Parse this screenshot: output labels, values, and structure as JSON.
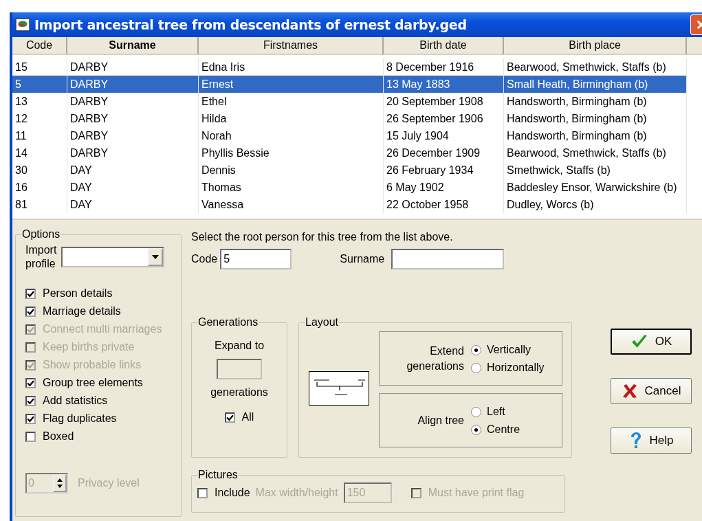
{
  "window": {
    "title": "Import ancestral tree from descendants of ernest darby.ged"
  },
  "table": {
    "columns": [
      {
        "label": "Code",
        "sorted": false
      },
      {
        "label": "Surname",
        "sorted": true
      },
      {
        "label": "Firstnames",
        "sorted": false
      },
      {
        "label": "Birth date",
        "sorted": false
      },
      {
        "label": "Birth place",
        "sorted": false
      }
    ],
    "rows": [
      {
        "cells": [
          "15",
          "DARBY",
          "Edna Iris",
          "8 December 1916",
          "Bearwood, Smethwick, Staffs (b)"
        ],
        "selected": false
      },
      {
        "cells": [
          "5",
          "DARBY",
          "Ernest",
          "13 May 1883",
          "Small Heath, Birmingham (b)"
        ],
        "selected": true
      },
      {
        "cells": [
          "13",
          "DARBY",
          "Ethel",
          "20 September 1908",
          "Handsworth, Birmingham (b)"
        ],
        "selected": false
      },
      {
        "cells": [
          "12",
          "DARBY",
          "Hilda",
          "26 September 1906",
          "Handsworth, Birmingham (b)"
        ],
        "selected": false
      },
      {
        "cells": [
          "11",
          "DARBY",
          "Norah",
          "15 July 1904",
          "Handsworth, Birmingham (b)"
        ],
        "selected": false
      },
      {
        "cells": [
          "14",
          "DARBY",
          "Phyllis Bessie",
          "26 December 1909",
          "Bearwood, Smethwick, Staffs (b)"
        ],
        "selected": false
      },
      {
        "cells": [
          "30",
          "DAY",
          "Dennis",
          "26 February 1934",
          "Smethwick, Staffs (b)"
        ],
        "selected": false
      },
      {
        "cells": [
          "16",
          "DAY",
          "Thomas",
          "6 May 1902",
          "Baddesley Ensor, Warwickshire (b)"
        ],
        "selected": false
      },
      {
        "cells": [
          "81",
          "DAY",
          "Vanessa",
          "22 October 1958",
          "Dudley, Worcs (b)"
        ],
        "selected": false
      }
    ]
  },
  "options": {
    "title": "Options",
    "import_profile": {
      "label": "Import profile"
    },
    "checkboxes": [
      {
        "label": "Person details",
        "checked": true,
        "disabled": false
      },
      {
        "label": "Marriage details",
        "checked": true,
        "disabled": false
      },
      {
        "label": "Connect multi marriages",
        "checked": true,
        "disabled": true
      },
      {
        "label": "Keep births private",
        "checked": false,
        "disabled": true
      },
      {
        "label": "Show probable links",
        "checked": true,
        "disabled": true
      },
      {
        "label": "Group tree elements",
        "checked": true,
        "disabled": false
      },
      {
        "label": "Add statistics",
        "checked": true,
        "disabled": false
      },
      {
        "label": "Flag duplicates",
        "checked": true,
        "disabled": false
      },
      {
        "label": "Boxed",
        "checked": false,
        "disabled": false
      }
    ],
    "privacy": {
      "value": "0",
      "label": "Privacy level",
      "disabled": true
    }
  },
  "root": {
    "prompt": "Select the root person for this tree from the list above.",
    "code": {
      "label": "Code",
      "value": "5"
    },
    "surname": {
      "label": "Surname"
    }
  },
  "generations": {
    "title": "Generations",
    "expand_label": "Expand to",
    "unit_label": "generations",
    "all": {
      "label": "All",
      "checked": true
    }
  },
  "layout": {
    "title": "Layout",
    "extend": {
      "label": "Extend generations",
      "radios": [
        {
          "label": "Vertically",
          "selected": true
        },
        {
          "label": "Horizontally",
          "selected": false
        }
      ]
    },
    "align": {
      "label": "Align tree",
      "radios": [
        {
          "label": "Left",
          "selected": false
        },
        {
          "label": "Centre",
          "selected": true
        }
      ]
    }
  },
  "pictures": {
    "title": "Pictures",
    "include": {
      "label": "Include",
      "checked": false
    },
    "max_size": {
      "label": "Max width/height",
      "value": "150",
      "disabled": true
    },
    "print_flag": {
      "label": "Must have print flag",
      "checked": false,
      "disabled": true
    }
  },
  "buttons": [
    {
      "label": "OK",
      "kind": "ok",
      "default": true
    },
    {
      "label": "Cancel",
      "kind": "cancel",
      "default": false
    },
    {
      "label": "Help",
      "kind": "help",
      "default": false
    }
  ]
}
